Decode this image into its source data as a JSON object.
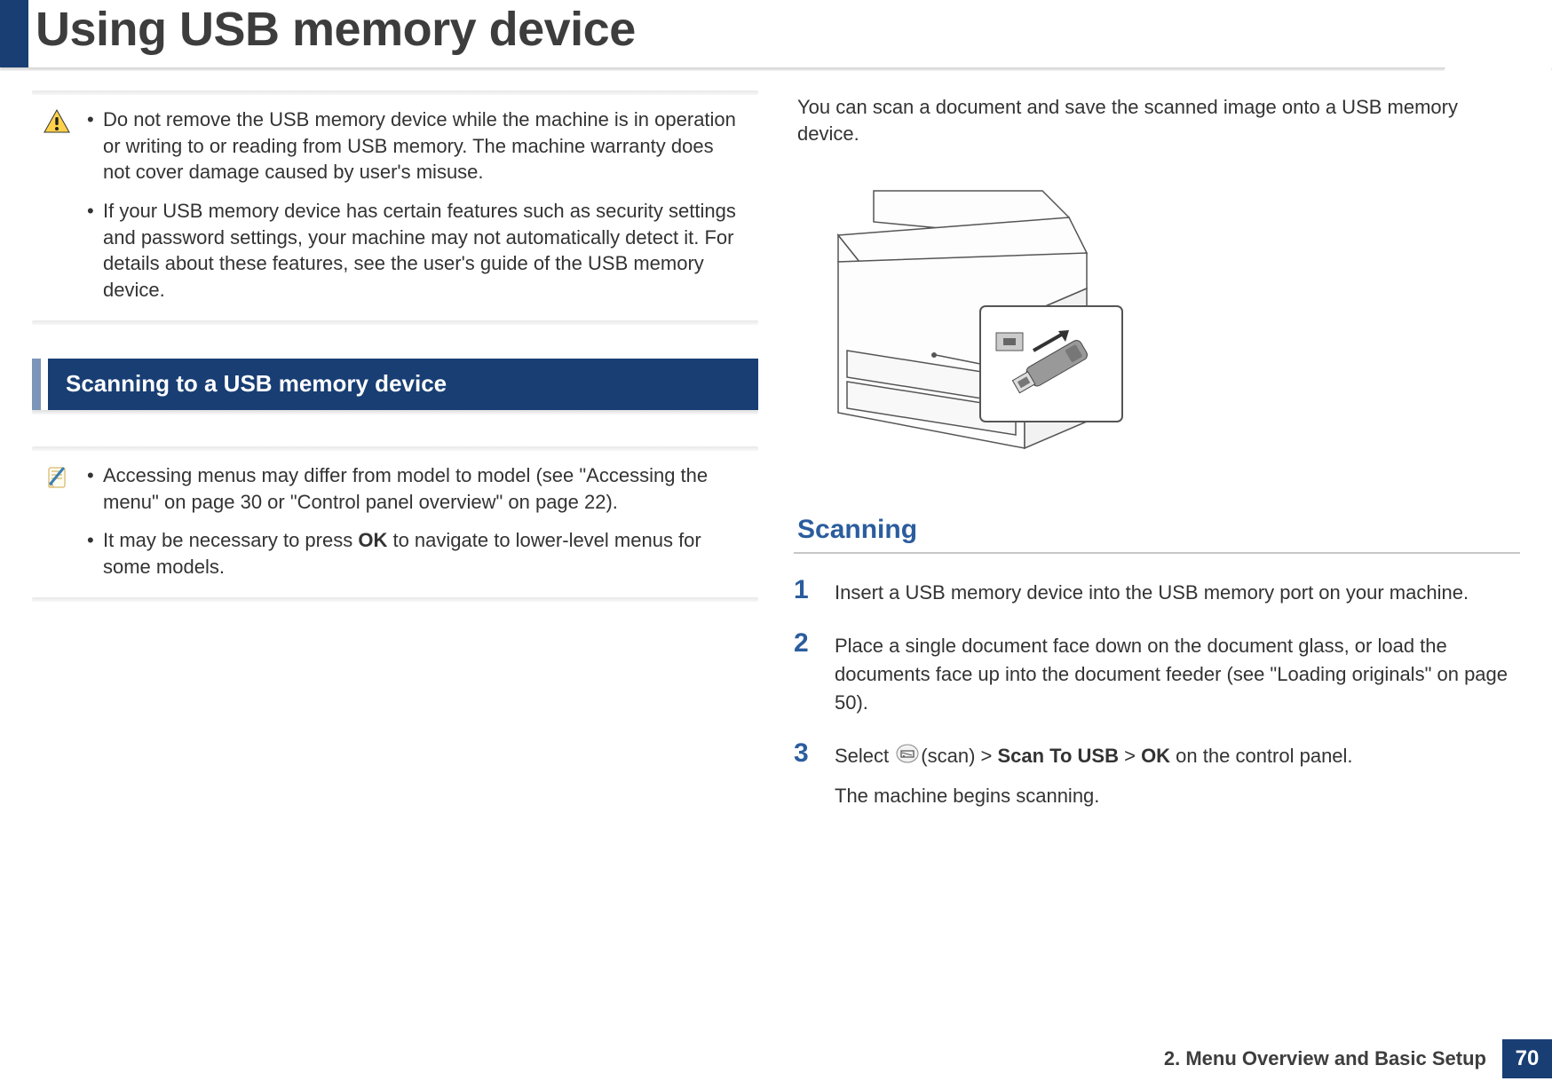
{
  "header": {
    "title": "Using USB memory device"
  },
  "left_column": {
    "warning_box": {
      "items": [
        "Do not remove the USB memory device while the machine is in operation or writing to or reading from USB memory. The machine warranty does not cover damage caused by user's misuse.",
        "If your USB memory device has certain features such as security settings and password settings, your machine may not automatically detect it. For details about these features, see the user's guide of the USB memory device."
      ]
    },
    "section_heading": "Scanning to a USB memory device",
    "note_box": {
      "item1_pre": "Accessing menus may differ from model to model (see \"Accessing the menu\" on page 30",
      "item1_or": " or ",
      "item1_post": "\"Control panel overview\" on page 22).",
      "item2_pre": "It may be necessary to press ",
      "item2_bold": "OK",
      "item2_post": " to navigate to lower-level menus for some models."
    }
  },
  "right_column": {
    "intro": "You can scan a document and save the scanned image onto a USB memory device.",
    "subsection_heading": "Scanning",
    "steps": {
      "s1": {
        "num": "1",
        "text": "Insert a USB memory device into the USB memory port on your machine."
      },
      "s2": {
        "num": "2",
        "text": "Place a single document face down on the document glass, or load the documents face up into the document feeder (see \"Loading originals\" on page 50)."
      },
      "s3": {
        "num": "3",
        "t1": "Select ",
        "t2": "(scan) > ",
        "bold1": "Scan To USB",
        "t3": " > ",
        "bold2": "OK",
        "t4": " on the control panel.",
        "followup": "The machine begins scanning."
      }
    }
  },
  "footer": {
    "chapter": "2. Menu Overview and Basic Setup",
    "page": "70"
  }
}
